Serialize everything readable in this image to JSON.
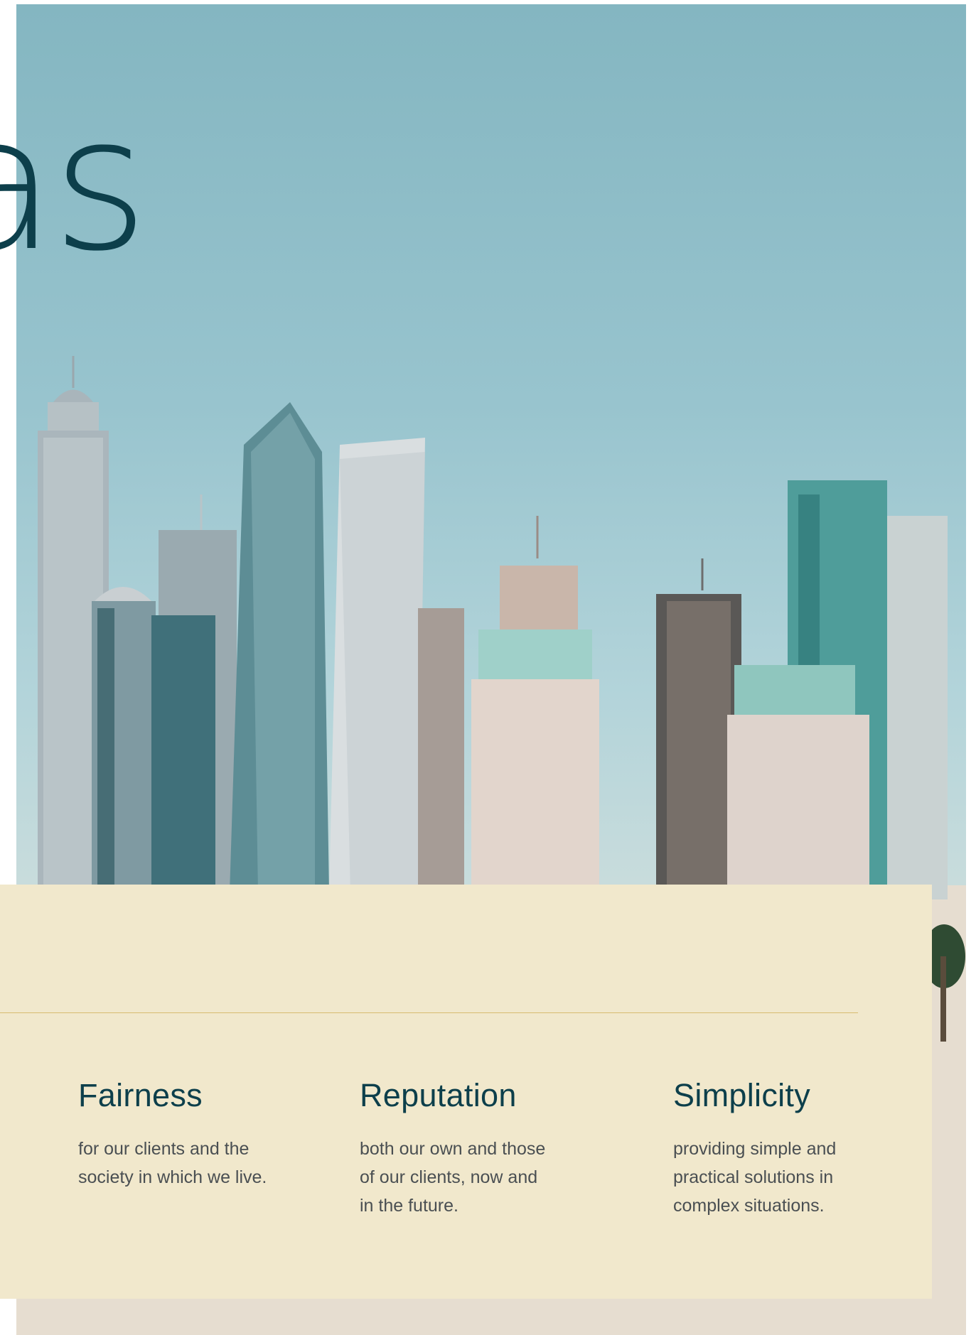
{
  "hero": {
    "partial_word": "as"
  },
  "values": [
    {
      "title": "Fairness",
      "description": "for our clients and the\nsociety in which we live."
    },
    {
      "title": "Reputation",
      "description": "both our own and those\nof our clients, now and\nin the future."
    },
    {
      "title": "Simplicity",
      "description": "providing simple and\npractical solutions in\ncomplex situations."
    }
  ],
  "colors": {
    "heading": "#0d3f4b",
    "body_text": "#4a4f52",
    "panel_background": "#f1e8cc",
    "divider": "#d8bc70",
    "sky": "#8fbfca"
  }
}
